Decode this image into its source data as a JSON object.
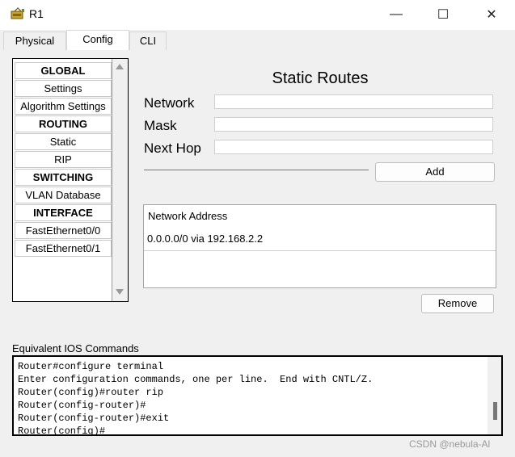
{
  "window": {
    "title": "R1",
    "minimize_glyph": "—",
    "maximize_glyph": "☐",
    "close_glyph": "✕"
  },
  "tabs": [
    {
      "label": "Physical"
    },
    {
      "label": "Config"
    },
    {
      "label": "CLI"
    }
  ],
  "sidebar": {
    "items": [
      {
        "label": "GLOBAL"
      },
      {
        "label": "Settings"
      },
      {
        "label": "Algorithm Settings"
      },
      {
        "label": "ROUTING"
      },
      {
        "label": "Static"
      },
      {
        "label": "RIP"
      },
      {
        "label": "SWITCHING"
      },
      {
        "label": "VLAN Database"
      },
      {
        "label": "INTERFACE"
      },
      {
        "label": "FastEthernet0/0"
      },
      {
        "label": "FastEthernet0/1"
      }
    ]
  },
  "static_routes": {
    "title": "Static Routes",
    "network_label": "Network",
    "mask_label": "Mask",
    "next_hop_label": "Next Hop",
    "network_value": "",
    "mask_value": "",
    "next_hop_value": "",
    "add_label": "Add",
    "table_header": "Network Address",
    "rows": [
      "0.0.0.0/0 via 192.168.2.2"
    ],
    "remove_label": "Remove"
  },
  "ios": {
    "label": "Equivalent IOS Commands",
    "lines": [
      "Router#configure terminal",
      "Enter configuration commands, one per line.  End with CNTL/Z.",
      "Router(config)#router rip",
      "Router(config-router)#",
      "Router(config-router)#exit",
      "Router(config)#"
    ]
  },
  "watermark": "CSDN @nebula-Al"
}
